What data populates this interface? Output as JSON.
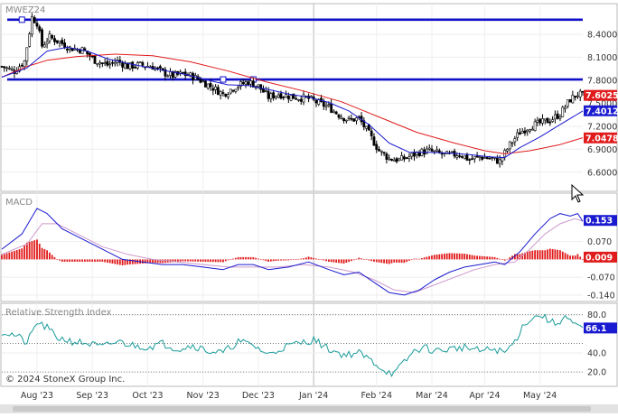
{
  "chart_data": [
    {
      "type": "candlestick",
      "symbol": "MWEZ24",
      "y_ticks": [
        "8.4000",
        "8.1000",
        "7.8000",
        "7.5000",
        "7.2000",
        "6.9000",
        "6.6000"
      ],
      "y_tick_values": [
        8.4,
        8.1,
        7.8,
        7.5,
        7.2,
        6.9,
        6.6
      ],
      "ylim": [
        6.35,
        8.8
      ],
      "x_ticks": [
        "Aug '23",
        "Sep '23",
        "Oct '23",
        "Nov '23",
        "Dec '23",
        "Jan '24",
        "Feb '24",
        "Mar '24",
        "Apr '24",
        "May '24"
      ],
      "x_tick_bar_index": [
        14,
        36,
        58,
        80,
        102,
        124,
        149,
        171,
        192,
        214
      ],
      "n_bars": 232,
      "horizontal_lines": [
        8.59,
        7.81
      ],
      "last_labels": [
        {
          "text": "7.6025",
          "value": 7.6025,
          "color": "#e01b1b"
        },
        {
          "text": "7.4012",
          "value": 7.4012,
          "color": "#1a1ad0"
        },
        {
          "text": "7.0478",
          "value": 7.0478,
          "color": "#e01b1b"
        }
      ],
      "price_path": [
        [
          0,
          7.98
        ],
        [
          5,
          7.92
        ],
        [
          9,
          8.05
        ],
        [
          12,
          8.62
        ],
        [
          14,
          8.55
        ],
        [
          16,
          8.25
        ],
        [
          19,
          8.36
        ],
        [
          23,
          8.3
        ],
        [
          27,
          8.22
        ],
        [
          32,
          8.2
        ],
        [
          37,
          8.06
        ],
        [
          42,
          8.0
        ],
        [
          46,
          8.05
        ],
        [
          50,
          7.98
        ],
        [
          55,
          8.0
        ],
        [
          60,
          7.98
        ],
        [
          64,
          7.9
        ],
        [
          68,
          7.86
        ],
        [
          72,
          7.88
        ],
        [
          76,
          7.85
        ],
        [
          80,
          7.78
        ],
        [
          84,
          7.7
        ],
        [
          88,
          7.62
        ],
        [
          93,
          7.72
        ],
        [
          98,
          7.78
        ],
        [
          102,
          7.72
        ],
        [
          106,
          7.58
        ],
        [
          110,
          7.62
        ],
        [
          116,
          7.58
        ],
        [
          122,
          7.56
        ],
        [
          126,
          7.5
        ],
        [
          130,
          7.45
        ],
        [
          134,
          7.35
        ],
        [
          138,
          7.28
        ],
        [
          142,
          7.3
        ],
        [
          146,
          7.1
        ],
        [
          150,
          6.88
        ],
        [
          154,
          6.78
        ],
        [
          158,
          6.76
        ],
        [
          162,
          6.8
        ],
        [
          166,
          6.86
        ],
        [
          170,
          6.88
        ],
        [
          174,
          6.84
        ],
        [
          178,
          6.82
        ],
        [
          182,
          6.84
        ],
        [
          186,
          6.76
        ],
        [
          190,
          6.8
        ],
        [
          194,
          6.78
        ],
        [
          198,
          6.74
        ],
        [
          202,
          6.96
        ],
        [
          206,
          7.12
        ],
        [
          210,
          7.2
        ],
        [
          214,
          7.24
        ],
        [
          218,
          7.28
        ],
        [
          222,
          7.36
        ],
        [
          226,
          7.55
        ],
        [
          229,
          7.62
        ],
        [
          231,
          7.6
        ]
      ],
      "series": [
        {
          "name": "",
          "color": "#1a1ad0",
          "points": [
            [
              0,
              7.84
            ],
            [
              10,
              7.96
            ],
            [
              18,
              8.18
            ],
            [
              26,
              8.23
            ],
            [
              34,
              8.18
            ],
            [
              42,
              8.08
            ],
            [
              50,
              8.02
            ],
            [
              58,
              7.97
            ],
            [
              66,
              7.92
            ],
            [
              74,
              7.87
            ],
            [
              82,
              7.8
            ],
            [
              90,
              7.74
            ],
            [
              98,
              7.73
            ],
            [
              106,
              7.68
            ],
            [
              114,
              7.62
            ],
            [
              122,
              7.58
            ],
            [
              130,
              7.51
            ],
            [
              138,
              7.4
            ],
            [
              146,
              7.22
            ],
            [
              154,
              6.98
            ],
            [
              162,
              6.86
            ],
            [
              170,
              6.86
            ],
            [
              178,
              6.85
            ],
            [
              186,
              6.83
            ],
            [
              194,
              6.8
            ],
            [
              200,
              6.79
            ],
            [
              206,
              6.92
            ],
            [
              214,
              7.06
            ],
            [
              222,
              7.22
            ],
            [
              228,
              7.34
            ],
            [
              231,
              7.4
            ]
          ]
        },
        {
          "name": "",
          "color": "#e01b1b",
          "points": [
            [
              0,
              7.84
            ],
            [
              10,
              7.98
            ],
            [
              18,
              8.06
            ],
            [
              30,
              8.11
            ],
            [
              45,
              8.14
            ],
            [
              60,
              8.12
            ],
            [
              75,
              8.04
            ],
            [
              90,
              7.92
            ],
            [
              105,
              7.78
            ],
            [
              120,
              7.66
            ],
            [
              135,
              7.52
            ],
            [
              150,
              7.32
            ],
            [
              165,
              7.12
            ],
            [
              180,
              6.98
            ],
            [
              192,
              6.88
            ],
            [
              200,
              6.84
            ],
            [
              210,
              6.88
            ],
            [
              222,
              6.96
            ],
            [
              231,
              7.05
            ]
          ]
        }
      ]
    },
    {
      "type": "line",
      "title": "MACD",
      "y_ticks": [
        "0.070",
        "-0.070",
        "-0.140"
      ],
      "y_tick_values": [
        0.07,
        -0.07,
        -0.14
      ],
      "ylim": [
        -0.165,
        0.26
      ],
      "last_labels": [
        {
          "text": "0.153",
          "value": 0.153,
          "color": "#1a1ad0"
        },
        {
          "text": "0.009",
          "value": 0.009,
          "color": "#e01b1b"
        }
      ],
      "series": [
        {
          "name": "",
          "color": "#1a1ad0",
          "points": [
            [
              0,
              0.04
            ],
            [
              8,
              0.1
            ],
            [
              14,
              0.2
            ],
            [
              18,
              0.18
            ],
            [
              24,
              0.12
            ],
            [
              32,
              0.08
            ],
            [
              40,
              0.04
            ],
            [
              48,
              0.0
            ],
            [
              56,
              -0.01
            ],
            [
              64,
              -0.02
            ],
            [
              72,
              -0.02
            ],
            [
              80,
              -0.03
            ],
            [
              88,
              -0.04
            ],
            [
              94,
              -0.02
            ],
            [
              100,
              -0.02
            ],
            [
              106,
              -0.04
            ],
            [
              114,
              -0.03
            ],
            [
              122,
              -0.01
            ],
            [
              130,
              -0.04
            ],
            [
              136,
              -0.06
            ],
            [
              142,
              -0.05
            ],
            [
              148,
              -0.09
            ],
            [
              154,
              -0.13
            ],
            [
              160,
              -0.14
            ],
            [
              166,
              -0.12
            ],
            [
              172,
              -0.08
            ],
            [
              178,
              -0.05
            ],
            [
              184,
              -0.03
            ],
            [
              190,
              -0.02
            ],
            [
              196,
              -0.01
            ],
            [
              200,
              -0.02
            ],
            [
              206,
              0.03
            ],
            [
              212,
              0.1
            ],
            [
              218,
              0.16
            ],
            [
              222,
              0.18
            ],
            [
              226,
              0.17
            ],
            [
              229,
              0.18
            ],
            [
              231,
              0.15
            ]
          ]
        },
        {
          "name": "",
          "color": "#cc99cc",
          "points": [
            [
              0,
              0.02
            ],
            [
              10,
              0.06
            ],
            [
              16,
              0.14
            ],
            [
              22,
              0.14
            ],
            [
              30,
              0.1
            ],
            [
              40,
              0.05
            ],
            [
              50,
              0.02
            ],
            [
              60,
              0.0
            ],
            [
              70,
              -0.01
            ],
            [
              80,
              -0.02
            ],
            [
              90,
              -0.03
            ],
            [
              100,
              -0.03
            ],
            [
              110,
              -0.03
            ],
            [
              120,
              -0.02
            ],
            [
              130,
              -0.03
            ],
            [
              140,
              -0.05
            ],
            [
              148,
              -0.08
            ],
            [
              156,
              -0.12
            ],
            [
              164,
              -0.13
            ],
            [
              172,
              -0.1
            ],
            [
              180,
              -0.07
            ],
            [
              188,
              -0.04
            ],
            [
              196,
              -0.02
            ],
            [
              204,
              -0.01
            ],
            [
              210,
              0.04
            ],
            [
              216,
              0.1
            ],
            [
              222,
              0.14
            ],
            [
              228,
              0.16
            ],
            [
              231,
              0.15
            ]
          ]
        }
      ],
      "histogram": {
        "color": "#e01b1b"
      }
    },
    {
      "type": "line",
      "title": "Relative Strength Index",
      "y_ticks": [
        "80.0",
        "40.0",
        "20.0"
      ],
      "y_tick_values": [
        80,
        40,
        20
      ],
      "dotted_levels": [
        80,
        50,
        20
      ],
      "ylim": [
        5,
        92
      ],
      "last_label": {
        "text": "66.1",
        "value": 66.1,
        "color": "#1a1ad0"
      },
      "series": [
        {
          "name": "",
          "color": "#1a9b9b",
          "points": [
            [
              0,
              62
            ],
            [
              6,
              58
            ],
            [
              10,
              50
            ],
            [
              14,
              72
            ],
            [
              18,
              66
            ],
            [
              22,
              56
            ],
            [
              28,
              52
            ],
            [
              34,
              50
            ],
            [
              40,
              46
            ],
            [
              46,
              52
            ],
            [
              52,
              48
            ],
            [
              58,
              46
            ],
            [
              64,
              50
            ],
            [
              70,
              44
            ],
            [
              76,
              48
            ],
            [
              82,
              42
            ],
            [
              88,
              40
            ],
            [
              94,
              52
            ],
            [
              100,
              48
            ],
            [
              106,
              38
            ],
            [
              112,
              46
            ],
            [
              118,
              50
            ],
            [
              124,
              54
            ],
            [
              130,
              44
            ],
            [
              136,
              38
            ],
            [
              142,
              40
            ],
            [
              148,
              30
            ],
            [
              152,
              22
            ],
            [
              156,
              18
            ],
            [
              160,
              30
            ],
            [
              164,
              42
            ],
            [
              168,
              46
            ],
            [
              172,
              42
            ],
            [
              178,
              44
            ],
            [
              184,
              46
            ],
            [
              190,
              42
            ],
            [
              196,
              44
            ],
            [
              200,
              40
            ],
            [
              204,
              52
            ],
            [
              208,
              72
            ],
            [
              214,
              80
            ],
            [
              220,
              70
            ],
            [
              224,
              78
            ],
            [
              228,
              68
            ],
            [
              231,
              66
            ]
          ]
        }
      ]
    }
  ],
  "copyright": "© 2024 StoneX Group Inc."
}
